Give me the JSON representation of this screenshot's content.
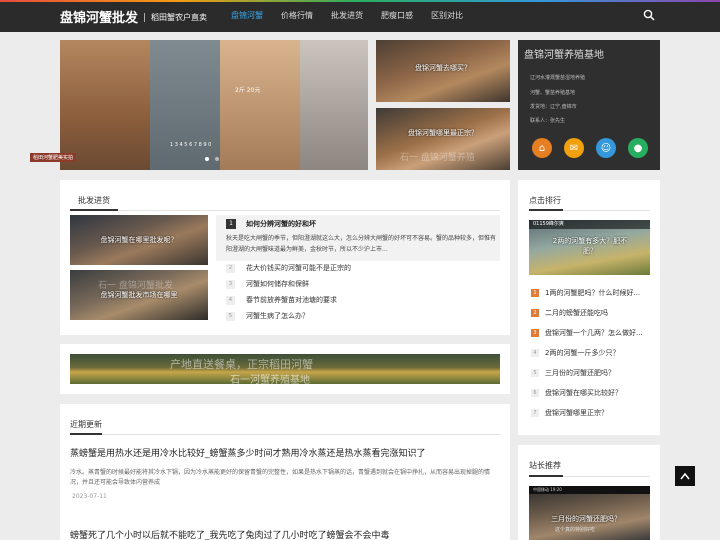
{
  "header": {
    "logo": "盘锦河蟹批发",
    "tagline": "稻田蟹农户直卖",
    "nav": [
      "盘锦河蟹",
      "价格行情",
      "批发进货",
      "肥瘦口感",
      "区别对比"
    ],
    "active_nav": 0
  },
  "hero": {
    "slide_tag": "稻田河蟹肥美实拍",
    "slide_text_1": "2斤 20元",
    "slide_text_2": "1 3 4 5 6 7 8 9 0",
    "tile1_caption": "盘锦河蟹去哪买？",
    "tile2_caption": "盘锦河蟹哪里最正宗？",
    "tile2_watermark": "石一 盘锦河蟹养殖"
  },
  "base": {
    "title": "盘锦河蟹养殖基地",
    "lines": [
      "辽河水灌溉蟹苗湿地养殖",
      "河蟹、蟹苗养殖基地",
      "发货地：辽宁,盘锦市",
      "联系人：张先生"
    ],
    "icons": [
      "home-icon",
      "mail-icon",
      "qq-icon",
      "wechat-icon"
    ],
    "icon_colors": [
      "#e67e22",
      "#f39c12",
      "#3498db",
      "#2ecc71"
    ]
  },
  "wholesale": {
    "title": "批发进货",
    "thumbs": [
      "盘锦河蟹在哪里批发呢？",
      "盘锦河蟹批发市场在哪里"
    ],
    "thumb2_watermark": "石一 盘锦河蟹批发",
    "featured": {
      "num": "1",
      "title": "如何分辨河蟹的好和坏",
      "desc": "秋天是吃大闸蟹的季节，但阳澄湖就这么大，怎么分辨大闸蟹的好坏可不容易。蟹的品种较多，但惟有阳澄湖的大闸蟹味道最为鲜美，金秋时节，所以不少沪上市..."
    },
    "items": [
      {
        "num": "2",
        "title": "花大价钱买的河蟹可能不是正宗的"
      },
      {
        "num": "3",
        "title": "河蟹如何储存和保鲜"
      },
      {
        "num": "4",
        "title": "春节前放养蟹苗对池塘的要求"
      },
      {
        "num": "5",
        "title": "河蟹生病了怎么办？"
      }
    ]
  },
  "banner": {
    "top_text": "产地直送餐桌，正宗稻田河蟹",
    "bottom_text": "石一河蟹养殖基地"
  },
  "recent": {
    "title": "近期更新",
    "articles": [
      {
        "title": "蒸螃蟹是用热水还是用冷水比较好_螃蟹蒸多少时间才熟用冷水蒸还是热水蒸看完涨知识了",
        "desc": "冷水。蒸青蟹的时候最好能将其冷水下锅，因为冷水蒸能更好的保留青蟹的完整性，如果是热水下锅蒸的话，青蟹遇到就会在锅中挣扎，从而容易出现掉腿的情况，并且还可能会导致体内营养成",
        "date": "2023-07-11"
      },
      {
        "title": "螃蟹死了几个小时以后就不能吃了_我先吃了兔肉过了几小时吃了螃蟹会不会中毒",
        "desc": "",
        "date": ""
      }
    ]
  },
  "ranking": {
    "title": "点击排行",
    "thumb_header": "01159峰尔爽",
    "thumb_caption": "2两的河蟹有多大？肥不肥？",
    "items": [
      {
        "num": "1",
        "title": "1两的河蟹肥吗？什么时候好..."
      },
      {
        "num": "2",
        "title": "二月的螃蟹还能吃吗"
      },
      {
        "num": "3",
        "title": "盘锦河蟹一个几两？怎么做好..."
      },
      {
        "num": "4",
        "title": "2两的河蟹一斤多少只？"
      },
      {
        "num": "5",
        "title": "三月份的河蟹还肥吗？"
      },
      {
        "num": "6",
        "title": "盘锦河蟹在哪买比较好？"
      },
      {
        "num": "7",
        "title": "盘锦河蟹哪里正宗？"
      }
    ]
  },
  "recommend": {
    "title": "站长推荐",
    "thumb_header": "中国移动 19:20",
    "thumb_caption": "三月份的河蟹还肥吗？",
    "thumb_sub": "这个真的特别好吃"
  }
}
